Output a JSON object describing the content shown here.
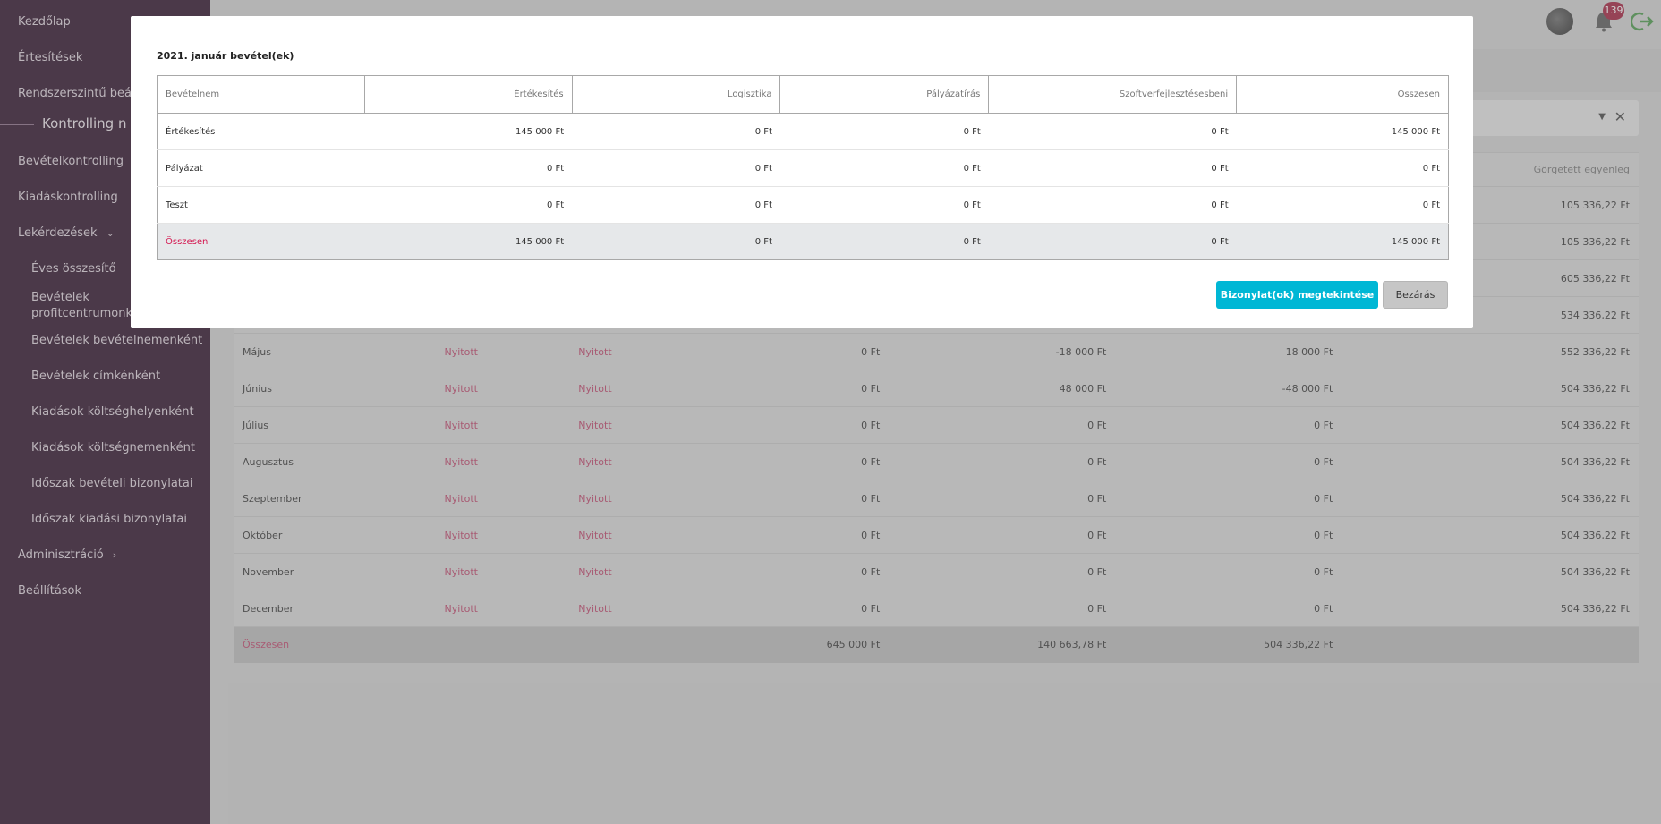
{
  "sidebar": {
    "items": [
      {
        "label": "Kezdőlap"
      },
      {
        "label": "Értesítések"
      },
      {
        "label": "Rendszerszintű beállítások"
      },
      {
        "label": "Bevételkontrolling"
      },
      {
        "label": "Kiadáskontrolling"
      },
      {
        "label": "Lekérdezések"
      },
      {
        "label": "Adminisztráció"
      },
      {
        "label": "Beállítások"
      }
    ],
    "section_title": "Kontrolling n",
    "sub_items": [
      {
        "label": "Éves összesítő"
      },
      {
        "label": "Bevételek profitcentrumonként"
      },
      {
        "label": "Bevételek bevételnemenként"
      },
      {
        "label": "Bevételek címkénként"
      },
      {
        "label": "Kiadások költséghelyenként"
      },
      {
        "label": "Kiadások költségnemenként"
      },
      {
        "label": "Időszak bevételi bizonylatai"
      },
      {
        "label": "Időszak kiadási bizonylatai"
      }
    ]
  },
  "topbar": {
    "notification_count": "139"
  },
  "background_table": {
    "last_header": "Görgetett egyenleg",
    "top_values": [
      "105 336,22 Ft",
      "105 336,22 Ft",
      "605 336,22 Ft",
      "534 336,22 Ft"
    ],
    "rows": [
      {
        "month": "Május",
        "s1": "Nyitott",
        "s2": "Nyitott",
        "v1": "0 Ft",
        "v2": "-18 000 Ft",
        "v3": "18 000 Ft",
        "v4": "552 336,22 Ft"
      },
      {
        "month": "Június",
        "s1": "Nyitott",
        "s2": "Nyitott",
        "v1": "0 Ft",
        "v2": "48 000 Ft",
        "v3": "-48 000 Ft",
        "v4": "504 336,22 Ft"
      },
      {
        "month": "Július",
        "s1": "Nyitott",
        "s2": "Nyitott",
        "v1": "0 Ft",
        "v2": "0 Ft",
        "v3": "0 Ft",
        "v4": "504 336,22 Ft"
      },
      {
        "month": "Augusztus",
        "s1": "Nyitott",
        "s2": "Nyitott",
        "v1": "0 Ft",
        "v2": "0 Ft",
        "v3": "0 Ft",
        "v4": "504 336,22 Ft"
      },
      {
        "month": "Szeptember",
        "s1": "Nyitott",
        "s2": "Nyitott",
        "v1": "0 Ft",
        "v2": "0 Ft",
        "v3": "0 Ft",
        "v4": "504 336,22 Ft"
      },
      {
        "month": "Október",
        "s1": "Nyitott",
        "s2": "Nyitott",
        "v1": "0 Ft",
        "v2": "0 Ft",
        "v3": "0 Ft",
        "v4": "504 336,22 Ft"
      },
      {
        "month": "November",
        "s1": "Nyitott",
        "s2": "Nyitott",
        "v1": "0 Ft",
        "v2": "0 Ft",
        "v3": "0 Ft",
        "v4": "504 336,22 Ft"
      },
      {
        "month": "December",
        "s1": "Nyitott",
        "s2": "Nyitott",
        "v1": "0 Ft",
        "v2": "0 Ft",
        "v3": "0 Ft",
        "v4": "504 336,22 Ft"
      }
    ],
    "total": {
      "label": "Összesen",
      "v1": "645 000 Ft",
      "v2": "140 663,78 Ft",
      "v3": "504 336,22 Ft"
    }
  },
  "modal": {
    "title": "2021. január bevétel(ek)",
    "headers": [
      "Bevételnem",
      "Értékesítés",
      "Logisztika",
      "Pályázatírás",
      "Szoftverfejlesztésesbeni",
      "Összesen"
    ],
    "rows": [
      [
        "Értékesítés",
        "145 000 Ft",
        "0 Ft",
        "0 Ft",
        "0 Ft",
        "145 000 Ft"
      ],
      [
        "Pályázat",
        "0 Ft",
        "0 Ft",
        "0 Ft",
        "0 Ft",
        "0 Ft"
      ],
      [
        "Teszt",
        "0 Ft",
        "0 Ft",
        "0 Ft",
        "0 Ft",
        "0 Ft"
      ]
    ],
    "total": [
      "Összesen",
      "145 000 Ft",
      "0 Ft",
      "0 Ft",
      "0 Ft",
      "145 000 Ft"
    ],
    "view_button": "Bizonylat(ok) megtekintése",
    "close_button": "Bezárás"
  },
  "colors": {
    "sidebar": "#2a0d27",
    "primary": "#00b7d5",
    "accent_red": "#d4164f",
    "badge": "#a31e3c"
  },
  "icons": [
    "chevron-down-icon",
    "chevron-right-icon",
    "bell-icon",
    "logout-icon",
    "avatar",
    "dropdown-caret-icon",
    "clear-icon"
  ]
}
